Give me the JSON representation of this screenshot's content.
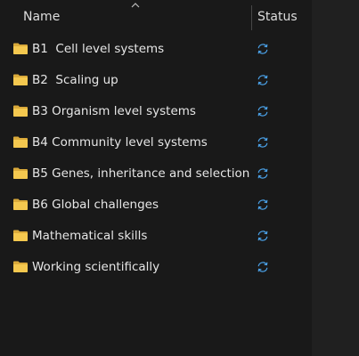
{
  "header": {
    "name_label": "Name",
    "status_label": "Status",
    "sort_icon": "chevron-up-icon"
  },
  "rows": [
    {
      "label": "B1  Cell level systems",
      "icon": "folder-icon",
      "status_icon": "sync-icon"
    },
    {
      "label": "B2  Scaling up",
      "icon": "folder-icon",
      "status_icon": "sync-icon"
    },
    {
      "label": "B3 Organism level systems",
      "icon": "folder-icon",
      "status_icon": "sync-icon"
    },
    {
      "label": "B4 Community level systems",
      "icon": "folder-icon",
      "status_icon": "sync-icon"
    },
    {
      "label": "B5 Genes, inheritance and selection",
      "icon": "folder-icon",
      "status_icon": "sync-icon"
    },
    {
      "label": "B6 Global challenges",
      "icon": "folder-icon",
      "status_icon": "sync-icon"
    },
    {
      "label": "Mathematical skills",
      "icon": "folder-icon",
      "status_icon": "sync-icon"
    },
    {
      "label": "Working scientifically",
      "icon": "folder-icon",
      "status_icon": "sync-icon"
    }
  ],
  "colors": {
    "background": "#191919",
    "folder": "#f4c84f",
    "sync": "#4aa0e6"
  }
}
